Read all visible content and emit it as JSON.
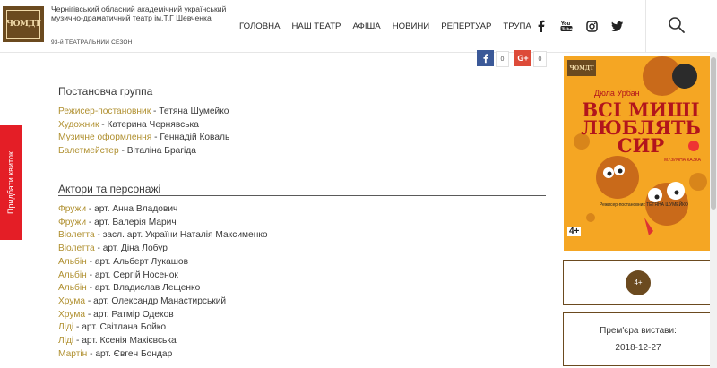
{
  "header": {
    "logo_text": "ЧОМДТ",
    "theatre_name": "Чернігівський обласний академічний український музично-драматичний театр ім.Т.Г Шевченка",
    "season": "93-й ТЕАТРАЛЬНИЙ СЕЗОН",
    "nav": [
      {
        "label": "ГОЛОВНА"
      },
      {
        "label": "НАШ ТЕАТР"
      },
      {
        "label": "АФІША"
      },
      {
        "label": "НОВИНИ"
      },
      {
        "label": "РЕПЕРТУАР"
      },
      {
        "label": "ТРУПА"
      }
    ],
    "social_icons": [
      "facebook-icon",
      "youtube-icon",
      "instagram-icon",
      "twitter-icon"
    ]
  },
  "share": {
    "facebook_count": "0",
    "gplus_label": "G+",
    "gplus_count": "0"
  },
  "ticket_tab": "Придбати квиток",
  "production_group": {
    "title": "Постановча группа",
    "items": [
      {
        "role": "Режисер-постановник",
        "person": "Тетяна Шумейко"
      },
      {
        "role": "Художник",
        "person": "Катерина Чернявська"
      },
      {
        "role": "Музичне оформлення",
        "person": "Геннадій Коваль"
      },
      {
        "role": "Балетмейстер",
        "person": "Віталіна Брагіда"
      }
    ]
  },
  "cast": {
    "title": "Актори та персонажі",
    "items": [
      {
        "role": "Фружи",
        "person": "арт. Анна Владович"
      },
      {
        "role": "Фружи",
        "person": "арт. Валерія Марич"
      },
      {
        "role": "Віолетта",
        "person": "засл. арт. України Наталія Максименко"
      },
      {
        "role": "Віолетта",
        "person": "арт. Діна Лобур"
      },
      {
        "role": "Альбін",
        "person": "арт. Альберт Лукашов"
      },
      {
        "role": "Альбін",
        "person": "арт. Сергій Носенок"
      },
      {
        "role": "Альбін",
        "person": "арт. Владислав Лещенко"
      },
      {
        "role": "Хрума",
        "person": "арт. Олександр Манастирський"
      },
      {
        "role": "Хрума",
        "person": "арт. Ратмір Одеков"
      },
      {
        "role": "Ліді",
        "person": "арт. Світлана Бойко"
      },
      {
        "role": "Ліді",
        "person": "арт. Ксенія Макієвська"
      },
      {
        "role": "Мартін",
        "person": "арт. Євген Бондар"
      }
    ]
  },
  "poster": {
    "logo": "ЧОМДТ",
    "author": "Дюла Урбан",
    "title_line1": "ВСІ МИШІ",
    "title_line2": "ЛЮБЛЯТЬ СИР",
    "genre": "МУЗИЧНА КАЗКА",
    "director_line": "Режисер-постановник ТЕТЯНА ШУМЕЙКО",
    "age": "4+"
  },
  "age_rating": "4+",
  "premiere": {
    "label": "Прем'єра вистави:",
    "date": "2018-12-27"
  },
  "colors": {
    "brand_brown": "#6b4a1f",
    "role_gold": "#b09030",
    "ticket_red": "#e41e26",
    "poster_orange": "#f5a623",
    "poster_red": "#b2151c",
    "facebook": "#3b5998",
    "gplus": "#dd4b39"
  }
}
